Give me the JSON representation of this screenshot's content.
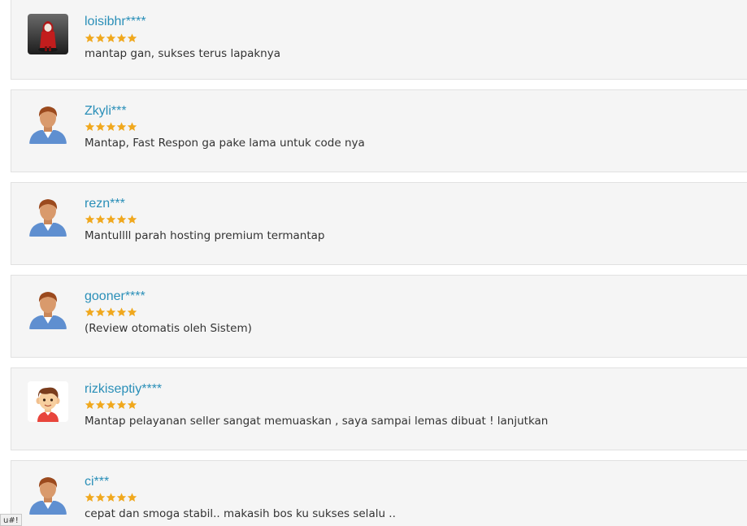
{
  "reviews": [
    {
      "username": "loisibhr****",
      "rating": 5,
      "comment": "mantap gan, sukses terus lapaknya",
      "avatar_icon": "masked-figure-avatar-icon"
    },
    {
      "username": "Zkyli***",
      "rating": 5,
      "comment": "Mantap, Fast Respon ga pake lama untuk code nya",
      "avatar_icon": "default-user-avatar-icon"
    },
    {
      "username": "rezn***",
      "rating": 5,
      "comment": "Mantullll parah hosting premium termantap",
      "avatar_icon": "default-user-avatar-icon"
    },
    {
      "username": "gooner****",
      "rating": 5,
      "comment": "(Review otomatis oleh Sistem)",
      "avatar_icon": "default-user-avatar-icon"
    },
    {
      "username": "rizkiseptiy****",
      "rating": 5,
      "comment": "Mantap pelayanan seller sangat memuaskan , saya sampai lemas dibuat ! lanjutkan",
      "avatar_icon": "cartoon-boy-avatar-icon"
    },
    {
      "username": "ci***",
      "rating": 5,
      "comment": "cepat dan smoga stabil.. makasih bos ku sukses selalu ..",
      "avatar_icon": "default-user-avatar-icon"
    }
  ],
  "status_tooltip": "u#!",
  "colors": {
    "username": "#2a8fb8",
    "star": "#f0a81e",
    "card_bg": "#f5f5f5",
    "text": "#333333"
  }
}
